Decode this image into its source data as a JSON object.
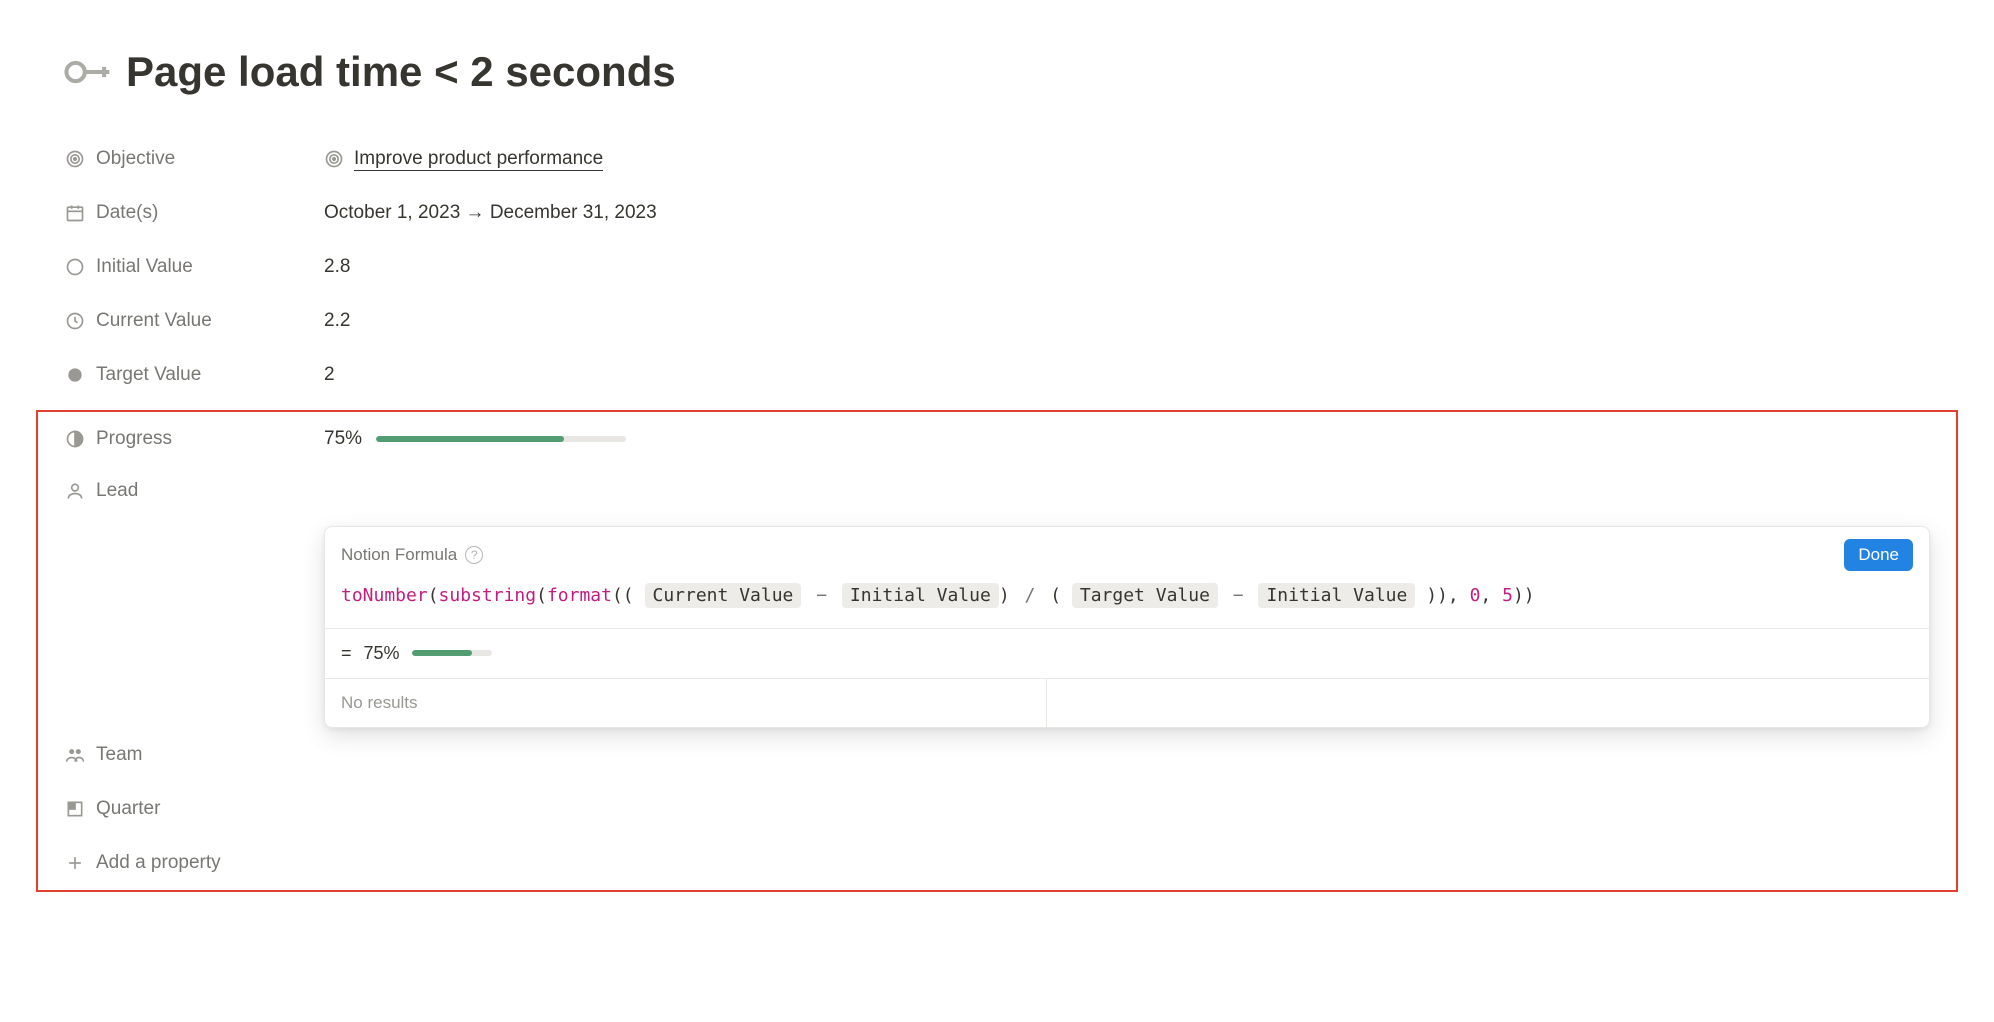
{
  "page": {
    "title": "Page load time < 2 seconds"
  },
  "props": {
    "objective": {
      "label": "Objective",
      "value": "Improve product performance"
    },
    "dates": {
      "label": "Date(s)",
      "value": "October 1, 2023 → December 31, 2023"
    },
    "initial": {
      "label": "Initial Value",
      "value": "2.8"
    },
    "current": {
      "label": "Current Value",
      "value": "2.2"
    },
    "target": {
      "label": "Target Value",
      "value": "2"
    },
    "progress": {
      "label": "Progress",
      "value": "75%",
      "percent": 75
    },
    "lead": {
      "label": "Lead"
    },
    "team": {
      "label": "Team"
    },
    "quarter": {
      "label": "Quarter"
    },
    "add": {
      "label": "Add a property"
    }
  },
  "formula": {
    "header": "Notion Formula",
    "done": "Done",
    "tokens": {
      "fn_toNumber": "toNumber",
      "fn_substring": "substring",
      "fn_format": "format",
      "var_current": "Current Value",
      "var_initial": "Initial Value",
      "var_target": "Target Value",
      "num_zero": "0",
      "num_five": "5",
      "op_minus": "−",
      "op_div": "/",
      "comma": ", "
    },
    "result_prefix": "=",
    "result_value": "75%",
    "result_percent": 75,
    "no_results": "No results"
  }
}
